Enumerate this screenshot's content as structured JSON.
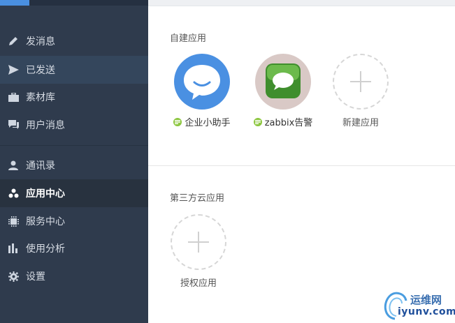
{
  "sidebar": {
    "items": [
      {
        "label": "发消息",
        "icon": "pencil-icon"
      },
      {
        "label": "已发送",
        "icon": "send-icon"
      },
      {
        "label": "素材库",
        "icon": "briefcase-icon"
      },
      {
        "label": "用户消息",
        "icon": "chat-icon"
      },
      {
        "label": "通讯录",
        "icon": "person-icon"
      },
      {
        "label": "应用中心",
        "icon": "apps-icon"
      },
      {
        "label": "服务中心",
        "icon": "chip-icon"
      },
      {
        "label": "使用分析",
        "icon": "bar-chart-icon"
      },
      {
        "label": "设置",
        "icon": "gear-icon"
      }
    ],
    "active": "应用中心",
    "highlighted": "已发送"
  },
  "main": {
    "custom_apps_title": "自建应用",
    "custom_apps": [
      {
        "label": "企业小助手",
        "icon": "speech-bubble-icon",
        "color": "#4a90e2"
      },
      {
        "label": "zabbix告警",
        "icon": "message-icon",
        "color": "#4a9a3a"
      }
    ],
    "new_app_label": "新建应用",
    "third_party_title": "第三方云应用",
    "authorize_label": "授权应用"
  },
  "watermark": {
    "line1": "运维网",
    "line2": "iyunv.com"
  }
}
